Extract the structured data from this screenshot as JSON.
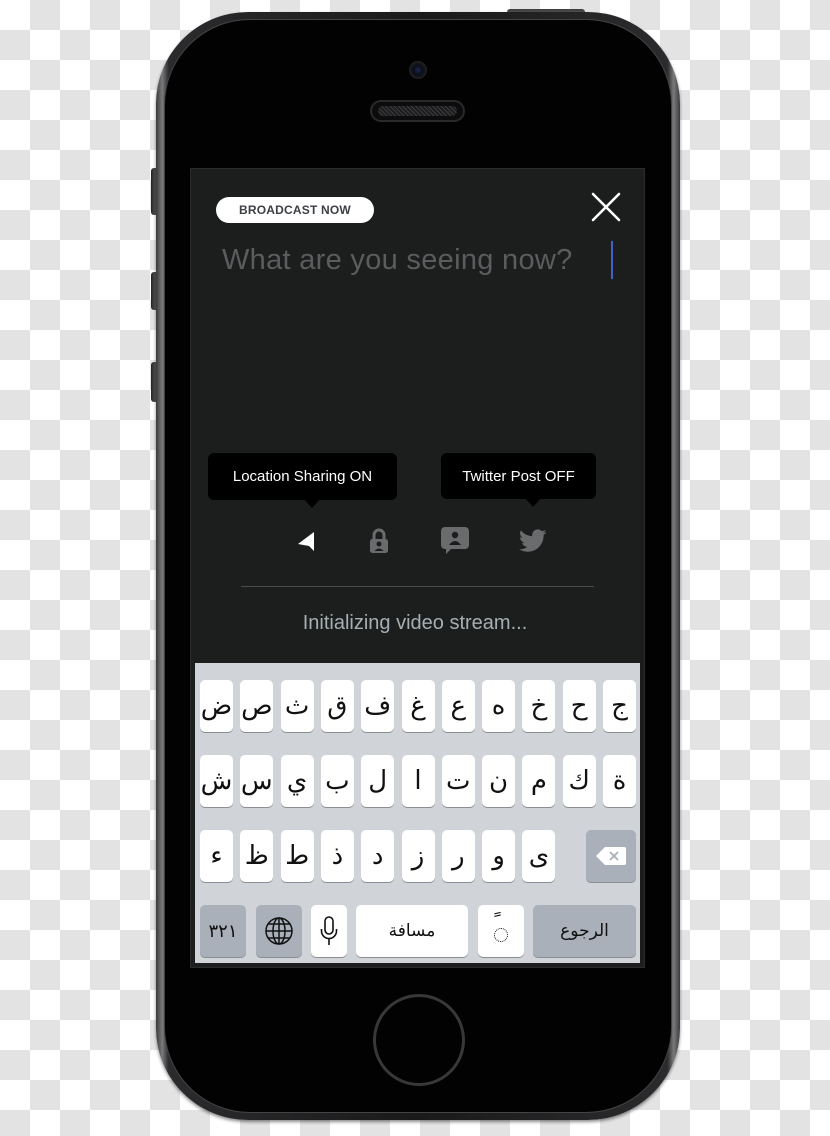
{
  "compose": {
    "badge_label": "BROADCAST NOW",
    "placeholder": "What are you seeing now?",
    "value": ""
  },
  "tooltips": {
    "location": "Location Sharing ON",
    "twitter": "Twitter Post OFF"
  },
  "options": [
    {
      "icon": "location-arrow-icon",
      "state": "on"
    },
    {
      "icon": "lock-icon",
      "state": "off"
    },
    {
      "icon": "chat-user-icon",
      "state": "off"
    },
    {
      "icon": "twitter-bird-icon",
      "state": "off"
    }
  ],
  "status_text": "Initializing video stream...",
  "keyboard": {
    "row1": [
      "ض",
      "ص",
      "ث",
      "ق",
      "ف",
      "غ",
      "ع",
      "ه",
      "خ",
      "ح",
      "ج"
    ],
    "row2": [
      "ش",
      "س",
      "ي",
      "ب",
      "ل",
      "ا",
      "ت",
      "ن",
      "م",
      "ك",
      "ة"
    ],
    "row3": [
      "ء",
      "ظ",
      "ط",
      "ذ",
      "د",
      "ز",
      "ر",
      "و",
      "ى"
    ],
    "numbers_key": "٣٢١",
    "space_key": "مسافة",
    "diacritic_key": "ً",
    "return_key": "الرجوع"
  },
  "colors": {
    "screen_bg": "#1c1d1d",
    "caret": "#4361c9",
    "icon_active": "#ffffff",
    "icon_inactive": "#6a6b6c",
    "keyboard_bg": "#d0d4d9"
  }
}
